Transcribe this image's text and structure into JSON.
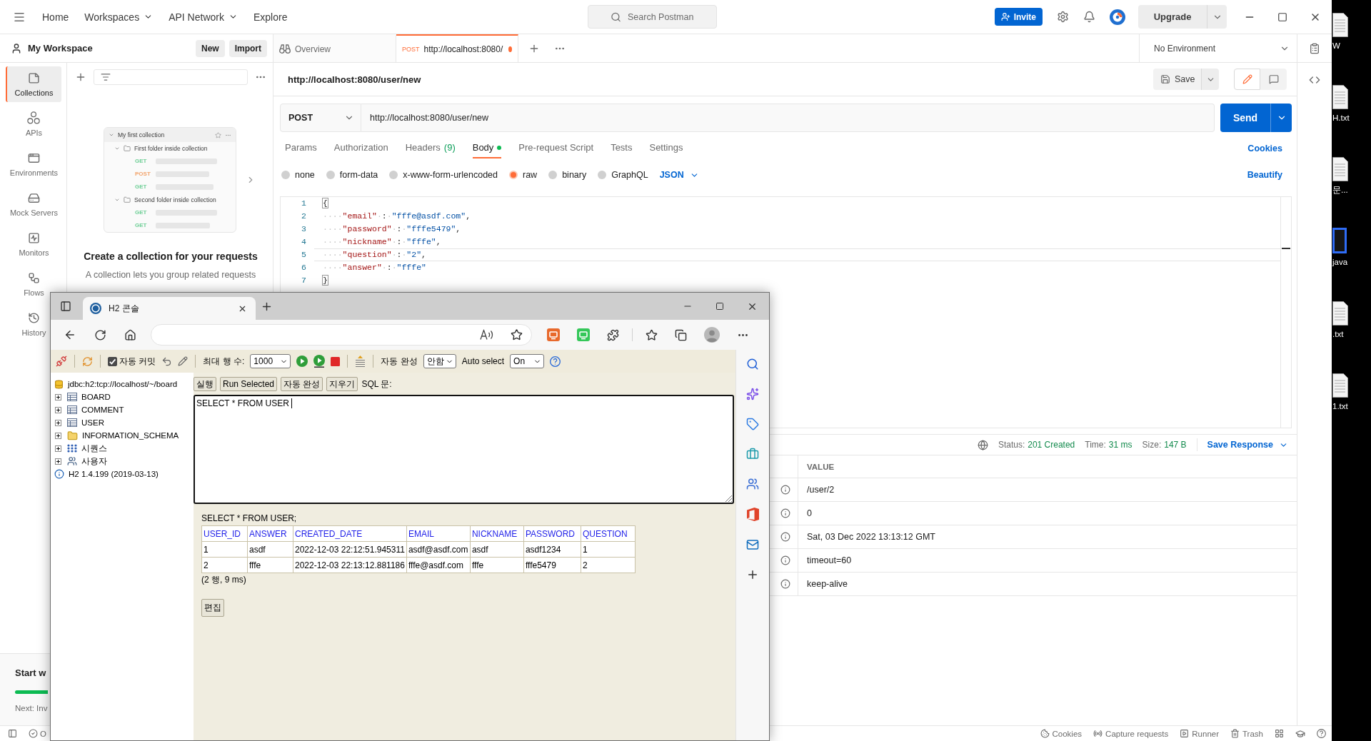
{
  "postman": {
    "top_nav": {
      "menu": [
        {
          "label": "Home",
          "dropdown": false
        },
        {
          "label": "Workspaces",
          "dropdown": true
        },
        {
          "label": "API Network",
          "dropdown": true
        },
        {
          "label": "Explore",
          "dropdown": false
        }
      ],
      "search": {
        "placeholder": "Search Postman"
      },
      "invite": "Invite",
      "upgrade": "Upgrade"
    },
    "workspace": {
      "title": "My Workspace",
      "buttons": [
        "New",
        "Import"
      ]
    },
    "sidebar_rail": [
      {
        "label": "Collections",
        "selected": true
      },
      {
        "label": "APIs",
        "selected": false
      },
      {
        "label": "Environments",
        "selected": false
      },
      {
        "label": "Mock Servers",
        "selected": false
      },
      {
        "label": "Monitors",
        "selected": false
      },
      {
        "label": "Flows",
        "selected": false
      },
      {
        "label": "History",
        "selected": false
      }
    ],
    "collections_panel": {
      "illustration": {
        "collection": "My first collection",
        "folders": [
          {
            "name": "First folder inside collection",
            "requests": [
              {
                "label": "GET",
                "color": "#6fcf97"
              },
              {
                "label": "POST",
                "color": "#f2a36b"
              },
              {
                "label": "GET",
                "color": "#6fcf97"
              }
            ]
          },
          {
            "name": "Second folder inside collection",
            "requests": [
              {
                "label": "GET",
                "color": "#6fcf97"
              },
              {
                "label": "GET",
                "color": "#6fcf97"
              }
            ]
          }
        ]
      },
      "title": "Create a collection for your requests",
      "text": "A collection lets you group related requests"
    },
    "onboarding": {
      "title": "Start w",
      "next": "Next: Inv"
    },
    "tabs": [
      {
        "kind": "overview",
        "label": "Overview",
        "selected": false
      },
      {
        "kind": "request",
        "method": "POST",
        "label": "http://localhost:8080/",
        "selected": true,
        "unsaved": true
      }
    ],
    "environment": "No Environment",
    "request": {
      "title": "http://localhost:8080/user/new",
      "save": "Save",
      "modes": [
        {
          "selected": true
        },
        {
          "selected": false
        }
      ],
      "method": "POST",
      "url": "http://localhost:8080/user/new",
      "send": "Send",
      "tabs": [
        {
          "label": "Params",
          "selected": false,
          "has_content": false
        },
        {
          "label": "Authorization",
          "selected": false,
          "has_content": false
        },
        {
          "label": "Headers",
          "count": "(9)",
          "selected": false,
          "has_content": false
        },
        {
          "label": "Body",
          "selected": true,
          "has_content": true
        },
        {
          "label": "Pre-request Script",
          "selected": false,
          "has_content": false
        },
        {
          "label": "Tests",
          "selected": false,
          "has_content": false
        },
        {
          "label": "Settings",
          "selected": false,
          "has_content": false
        }
      ],
      "cookies": "Cookies",
      "body_modes": [
        {
          "label": "none",
          "selected": false
        },
        {
          "label": "form-data",
          "selected": false
        },
        {
          "label": "x-www-form-urlencoded",
          "selected": false
        },
        {
          "label": "raw",
          "selected": true
        },
        {
          "label": "binary",
          "selected": false
        },
        {
          "label": "GraphQL",
          "selected": false
        }
      ],
      "format": "JSON",
      "beautify": "Beautify",
      "code": [
        {
          "number": "1",
          "active": false,
          "tokens": [
            {
              "kind": "bracket",
              "text": "{"
            }
          ]
        },
        {
          "number": "2",
          "active": false,
          "tokens": [
            {
              "kind": "space",
              "text": "····"
            },
            {
              "kind": "key",
              "text": "\"email\""
            },
            {
              "kind": "space",
              "text": "·"
            },
            {
              "kind": "punct",
              "text": ":"
            },
            {
              "kind": "space",
              "text": "·"
            },
            {
              "kind": "string",
              "text": "\"fffe@asdf.com\""
            },
            {
              "kind": "punct",
              "text": ","
            }
          ]
        },
        {
          "number": "3",
          "active": false,
          "tokens": [
            {
              "kind": "space",
              "text": "····"
            },
            {
              "kind": "key",
              "text": "\"password\""
            },
            {
              "kind": "space",
              "text": "·"
            },
            {
              "kind": "punct",
              "text": ":"
            },
            {
              "kind": "space",
              "text": "·"
            },
            {
              "kind": "string",
              "text": "\"fffe5479\""
            },
            {
              "kind": "punct",
              "text": ","
            }
          ]
        },
        {
          "number": "4",
          "active": false,
          "tokens": [
            {
              "kind": "space",
              "text": "····"
            },
            {
              "kind": "key",
              "text": "\"nickname\""
            },
            {
              "kind": "space",
              "text": "·"
            },
            {
              "kind": "punct",
              "text": ":"
            },
            {
              "kind": "space",
              "text": "·"
            },
            {
              "kind": "string",
              "text": "\"fffe\""
            },
            {
              "kind": "punct",
              "text": ","
            }
          ]
        },
        {
          "number": "5",
          "active": true,
          "tokens": [
            {
              "kind": "space",
              "text": "····"
            },
            {
              "kind": "key",
              "text": "\"question\""
            },
            {
              "kind": "space",
              "text": "·"
            },
            {
              "kind": "punct",
              "text": ":"
            },
            {
              "kind": "space",
              "text": "·"
            },
            {
              "kind": "string",
              "text": "\"2\""
            },
            {
              "kind": "punct",
              "text": ","
            }
          ]
        },
        {
          "number": "6",
          "active": false,
          "tokens": [
            {
              "kind": "space",
              "text": "····"
            },
            {
              "kind": "key",
              "text": "\"answer\""
            },
            {
              "kind": "space",
              "text": "·"
            },
            {
              "kind": "punct",
              "text": ":"
            },
            {
              "kind": "space",
              "text": "·"
            },
            {
              "kind": "string",
              "text": "\"fffe\""
            }
          ]
        },
        {
          "number": "7",
          "active": false,
          "tokens": [
            {
              "kind": "bracket",
              "text": "}"
            }
          ]
        }
      ]
    },
    "response": {
      "status_label": "Status:",
      "status": "201 Created",
      "time_label": "Time:",
      "time": "31 ms",
      "size_label": "Size:",
      "size": "147 B",
      "save": "Save Response",
      "column": "VALUE",
      "values": [
        "/user/2",
        "0",
        "Sat, 03 Dec 2022 13:13:12 GMT",
        "timeout=60",
        "keep-alive"
      ]
    },
    "status_bar": {
      "status": "O",
      "items": [
        "Cookies",
        "Capture requests",
        "Runner",
        "Trash"
      ]
    }
  },
  "desktop_icons": [
    {
      "label": "W",
      "kind": "document"
    },
    {
      "label": "H.txt",
      "kind": "document"
    },
    {
      "label": "문...",
      "kind": "document"
    },
    {
      "label": "java",
      "kind": "program"
    },
    {
      "label": ".txt",
      "kind": "document"
    },
    {
      "label": "1.txt",
      "kind": "document"
    }
  ],
  "browser": {
    "tab_title": "H2 콘솔",
    "h2": {
      "toolbar": {
        "autocommit": {
          "label": "자동 커밋",
          "checked": true
        },
        "max_rows": {
          "label": "최대 행 수:",
          "value": "1000"
        },
        "autocomplete": {
          "label": "자동 완성",
          "value": "안함"
        },
        "auto_select": {
          "label": "Auto select",
          "value": "On"
        }
      },
      "tree": {
        "connection": "jdbc:h2:tcp://localhost/~/board",
        "items": [
          {
            "label": "BOARD",
            "kind": "table"
          },
          {
            "label": "COMMENT",
            "kind": "table"
          },
          {
            "label": "USER",
            "kind": "table"
          },
          {
            "label": "INFORMATION_SCHEMA",
            "kind": "folder"
          },
          {
            "label": "시퀀스",
            "kind": "sequence"
          },
          {
            "label": "사용자",
            "kind": "users"
          }
        ],
        "version": "H2 1.4.199 (2019-03-13)"
      },
      "query_buttons": [
        "실행",
        "Run Selected",
        "자동 완성",
        "지우기"
      ],
      "sql_label": "SQL 문:",
      "sql": "SELECT * FROM USER",
      "result": {
        "query": "SELECT * FROM USER;",
        "columns": [
          "USER_ID",
          "ANSWER",
          "CREATED_DATE",
          "EMAIL",
          "NICKNAME",
          "PASSWORD",
          "QUESTION"
        ],
        "rows": [
          [
            "1",
            "asdf",
            "2022-12-03 22:12:51.945311",
            "asdf@asdf.com",
            "asdf",
            "asdf1234",
            "1"
          ],
          [
            "2",
            "fffe",
            "2022-12-03 22:13:12.881186",
            "fffe@asdf.com",
            "fffe",
            "fffe5479",
            "2"
          ]
        ],
        "summary": "(2 행, 9 ms)",
        "edit": "편집"
      }
    }
  }
}
